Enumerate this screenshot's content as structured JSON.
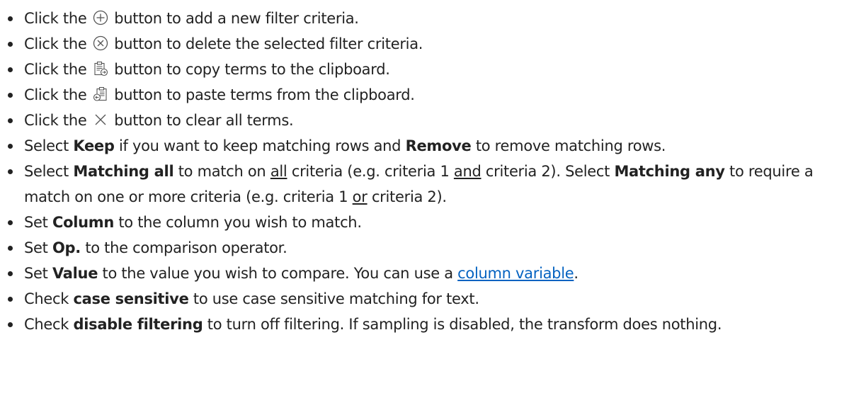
{
  "items": [
    {
      "pre": "Click the",
      "icon": "plus-circle-icon",
      "post": "button to add a new filter criteria."
    },
    {
      "pre": "Click the",
      "icon": "delete-circle-icon",
      "post": "button to delete the selected filter criteria."
    },
    {
      "pre": "Click the",
      "icon": "copy-clipboard-icon",
      "post": "button to copy terms to the clipboard."
    },
    {
      "pre": "Click the",
      "icon": "paste-clipboard-icon",
      "post": "button to paste terms from the clipboard."
    },
    {
      "pre": "Click the",
      "icon": "clear-x-icon",
      "post": "button to clear all terms."
    }
  ],
  "keep_item": {
    "pre": "Select ",
    "keep": "Keep",
    "mid": " if you want to keep matching rows and ",
    "remove": "Remove",
    "post": " to remove matching rows."
  },
  "matching_item": {
    "pre": "Select ",
    "matching_all": "Matching all",
    "t1": " to match on ",
    "all": "all",
    "t2": " criteria (e.g. criteria 1 ",
    "and": "and",
    "t3": " criteria 2). Select ",
    "matching_any": "Matching any",
    "t4": " to require a match on one or more criteria (e.g. criteria 1 ",
    "or": "or",
    "t5": " criteria 2)."
  },
  "column_item": {
    "pre": "Set ",
    "bold": "Column",
    "post": " to the column you wish to match."
  },
  "op_item": {
    "pre": "Set ",
    "bold": "Op.",
    "post": " to the comparison operator."
  },
  "value_item": {
    "pre": "Set ",
    "bold": "Value",
    "mid": " to the value you wish to compare. You can use a ",
    "link": "column variable",
    "post": "."
  },
  "case_item": {
    "pre": "Check ",
    "bold": "case sensitive",
    "post": " to use case sensitive matching for text."
  },
  "disable_item": {
    "pre": "Check ",
    "bold": "disable filtering",
    "post": " to turn off filtering. If sampling is disabled, the transform does nothing."
  },
  "icon_colors": {
    "stroke": "#555555"
  },
  "link_color": "#0563c1"
}
